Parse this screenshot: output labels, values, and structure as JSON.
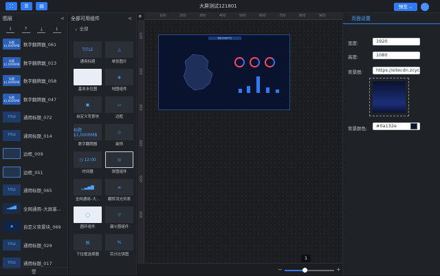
{
  "toolbar": {
    "btn1": "⛚",
    "btn2": "☰",
    "btn3": "▤",
    "title": "大屏测试121801",
    "preview": "预览 ⌄"
  },
  "layers": {
    "title": "图层",
    "tools": [
      "⭱",
      "⤒",
      "⤓",
      "⭳"
    ],
    "items": [
      {
        "label": "数字翻牌器_061",
        "type": "num"
      },
      {
        "label": "数字翻牌器_013",
        "type": "num"
      },
      {
        "label": "数字翻牌器_058",
        "type": "num"
      },
      {
        "label": "数字翻牌器_047",
        "type": "num"
      },
      {
        "label": "通用标题_072",
        "type": "title"
      },
      {
        "label": "通用标题_014",
        "type": "title"
      },
      {
        "label": "边框_009",
        "type": "border"
      },
      {
        "label": "边框_051",
        "type": "border"
      },
      {
        "label": "通用标题_065",
        "type": "title"
      },
      {
        "label": "全网通用–大屏基...",
        "type": "bar"
      },
      {
        "label": "自定义背景块_069",
        "type": "bg"
      },
      {
        "label": "通用标题_029",
        "type": "title"
      },
      {
        "label": "通用标题_017",
        "type": "title"
      }
    ],
    "thumb_num_top": "标题",
    "thumb_num_bottom": "$1,000RMB",
    "thumb_title": "TITLE",
    "delete": "🗑"
  },
  "components": {
    "title": "全部可用组件",
    "category": "⌄  全部",
    "items": [
      {
        "label": "通用标题",
        "thumb": "TITLE"
      },
      {
        "label": "单张图片",
        "thumb": "△"
      },
      {
        "label": "基本水位图",
        "thumb": ""
      },
      {
        "label": "地图组件",
        "thumb": "◈"
      },
      {
        "label": "自定义背景块",
        "thumb": "▣"
      },
      {
        "label": "边框",
        "thumb": "▭"
      },
      {
        "label": "数字翻牌器",
        "thumb": "标题 $1,000RMB"
      },
      {
        "label": "装饰",
        "thumb": "◇"
      },
      {
        "label": "时间器",
        "thumb": "◷ 12:00"
      },
      {
        "label": "饼图组件",
        "thumb": "◎"
      },
      {
        "label": "全网通用–大...",
        "thumb": "▁▃▅▇"
      },
      {
        "label": "翻转流光列表",
        "thumb": "≡"
      },
      {
        "label": "圆环组件",
        "thumb": "◯"
      },
      {
        "label": "漏斗图组件",
        "thumb": "▽"
      },
      {
        "label": "下拉框选择器",
        "thumb": "▤"
      },
      {
        "label": "百分比饼图",
        "thumb": "%"
      }
    ]
  },
  "canvas": {
    "ruler_top": [
      "100",
      "200",
      "300",
      "400",
      "500",
      "600",
      "700",
      "800",
      "900"
    ],
    "ruler_left": [
      "100",
      "200",
      "300",
      "400",
      "500",
      "600"
    ],
    "screen_title": "数据大屏展示平台",
    "zoom": "1",
    "zoom_minus": "−",
    "zoom_plus": "+"
  },
  "props": {
    "tab": "页面设置",
    "width_label": "宽度:",
    "width_value": "1920",
    "height_label": "高度:",
    "height_value": "1080",
    "bg_image_label": "背景图:",
    "bg_image_value": "https://sitecdn.zcycdn",
    "bg_color_label": "背景颜色:",
    "bg_color_value": "#0a132e"
  },
  "colors": {
    "accent": "#2f7bf5",
    "screen_bg": "#0a132e"
  }
}
